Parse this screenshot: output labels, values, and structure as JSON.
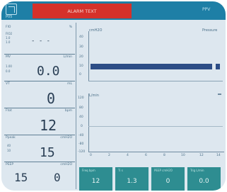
{
  "header": {
    "alarm_text": "ALARM TEXT",
    "mode": "PPV",
    "left_code": "P05"
  },
  "params": [
    {
      "label": "FIO",
      "unit": "%",
      "value": "- - -",
      "sub": [
        "FIO2",
        "1.0",
        "1.0"
      ]
    },
    {
      "label": "MV",
      "unit": "L/min",
      "value": "0.0",
      "sub": [
        "1.00",
        "0.0"
      ]
    },
    {
      "label": "VT",
      "unit": "mL",
      "value": "0"
    },
    {
      "label": "Ftot",
      "unit": "bpm",
      "value": "12"
    },
    {
      "label": "Ppeak",
      "unit": "cmH2O",
      "value": "15",
      "sub": [
        "40",
        "10"
      ]
    },
    {
      "label": "PEEP",
      "unit": "cmH2O",
      "value": "15",
      "value2": "0"
    }
  ],
  "graph": {
    "top_label": "cmH2O",
    "top_right_label": "Pressure",
    "top_ticks": [
      "40",
      "30",
      "20",
      "10",
      "0"
    ],
    "bottom_label": "L/min",
    "bottom_ticks": [
      "120",
      "80",
      "40",
      "0",
      "-40",
      "-80",
      "-120"
    ],
    "x_ticks": [
      "0",
      "2",
      "4",
      "6",
      "8",
      "10",
      "12",
      "14"
    ]
  },
  "tiles": [
    {
      "label": "Freq bpm",
      "value": "12"
    },
    {
      "label": "Ti s",
      "value": "1.3"
    },
    {
      "label": "PEEP cmH2O",
      "value": "0"
    },
    {
      "label": "Trig L/min",
      "value": "0.0"
    }
  ],
  "colors": {
    "header": "#1e7fa6",
    "alarm": "#d5312a",
    "screen": "#dde7ef",
    "trace": "#2c4d86",
    "tile": "#2e8d91"
  }
}
